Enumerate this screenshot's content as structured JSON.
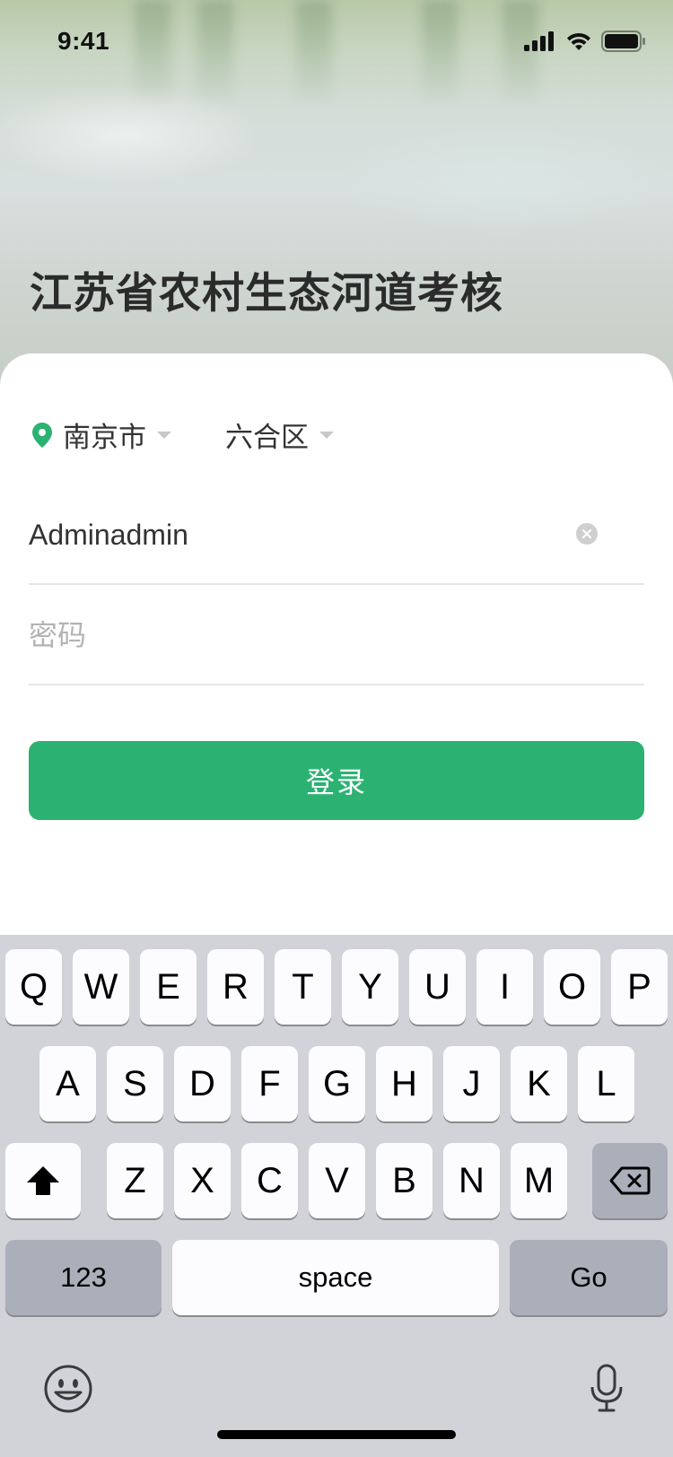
{
  "status_bar": {
    "time": "9:41"
  },
  "app": {
    "title": "江苏省农村生态河道考核"
  },
  "region": {
    "city": "南京市",
    "district": "六合区"
  },
  "form": {
    "username_value": "Adminadmin",
    "password_placeholder": "密码",
    "login_label": "登录"
  },
  "colors": {
    "accent": "#2bb273",
    "keyboard_bg": "#d1d3d9"
  },
  "keyboard": {
    "row1": [
      "Q",
      "W",
      "E",
      "R",
      "T",
      "Y",
      "U",
      "I",
      "O",
      "P"
    ],
    "row2": [
      "A",
      "S",
      "D",
      "F",
      "G",
      "H",
      "J",
      "K",
      "L"
    ],
    "row3": [
      "Z",
      "X",
      "C",
      "V",
      "B",
      "N",
      "M"
    ],
    "numbers_label": "123",
    "space_label": "space",
    "go_label": "Go"
  },
  "icons": [
    "cellular-signal-icon",
    "wifi-icon",
    "battery-icon",
    "location-pin-icon",
    "clear-icon",
    "shift-icon",
    "backspace-icon",
    "emoji-icon",
    "microphone-icon"
  ]
}
